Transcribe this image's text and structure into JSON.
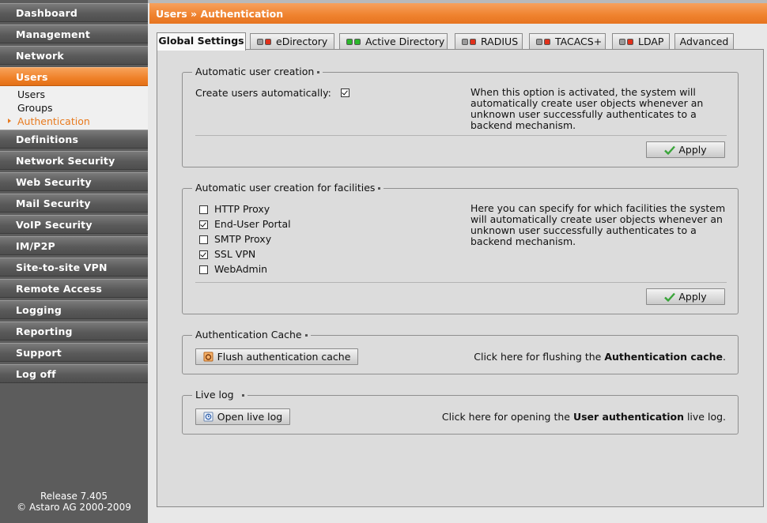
{
  "sidebar": {
    "items": [
      {
        "label": "Dashboard"
      },
      {
        "label": "Management"
      },
      {
        "label": "Network"
      },
      {
        "label": "Users"
      },
      {
        "label": "Definitions"
      },
      {
        "label": "Network Security"
      },
      {
        "label": "Web Security"
      },
      {
        "label": "Mail Security"
      },
      {
        "label": "VoIP Security"
      },
      {
        "label": "IM/P2P"
      },
      {
        "label": "Site-to-site VPN"
      },
      {
        "label": "Remote Access"
      },
      {
        "label": "Logging"
      },
      {
        "label": "Reporting"
      },
      {
        "label": "Support"
      },
      {
        "label": "Log off"
      }
    ],
    "active_index": 3,
    "subitems": [
      {
        "label": "Users"
      },
      {
        "label": "Groups"
      },
      {
        "label": "Authentication",
        "current": true
      }
    ],
    "footer": {
      "release": "Release 7.405",
      "copyright": "© Astaro AG 2000-2009"
    }
  },
  "header": {
    "breadcrumb": "Users » Authentication"
  },
  "tabs": [
    {
      "label": "Global Settings",
      "active": true,
      "led": ""
    },
    {
      "label": "eDirectory",
      "led": "red"
    },
    {
      "label": "Active Directory",
      "led": "green"
    },
    {
      "label": "RADIUS",
      "led": "red"
    },
    {
      "label": "TACACS+",
      "led": "red"
    },
    {
      "label": "LDAP",
      "led": "red"
    },
    {
      "label": "Advanced",
      "led": ""
    }
  ],
  "sections": {
    "auto_create": {
      "legend": "Automatic user creation",
      "checkbox_label": "Create users automatically:",
      "checked": true,
      "help": [
        "When this option is activated, the system will",
        "automatically create user objects whenever an",
        "unknown user successfully authenticates to a",
        "backend mechanism."
      ],
      "apply_label": "Apply"
    },
    "facilities": {
      "legend": "Automatic user creation for facilities",
      "options": [
        {
          "label": "HTTP Proxy",
          "checked": false
        },
        {
          "label": "End-User Portal",
          "checked": true
        },
        {
          "label": "SMTP Proxy",
          "checked": false
        },
        {
          "label": "SSL VPN",
          "checked": true
        },
        {
          "label": "WebAdmin",
          "checked": false
        }
      ],
      "help": [
        "Here you can specify for which facilities the system",
        "will automatically create user objects whenever an",
        "unknown user successfully authenticates to a",
        "backend mechanism."
      ],
      "apply_label": "Apply"
    },
    "cache": {
      "legend": "Authentication Cache",
      "button_label": "Flush authentication cache",
      "hint_prefix": "Click here for flushing the ",
      "hint_bold": "Authentication cache",
      "hint_suffix": "."
    },
    "live_log": {
      "legend": "Live log",
      "button_label": "Open live log",
      "hint_prefix": "Click here for opening the ",
      "hint_bold": "User authentication",
      "hint_suffix": " live log."
    }
  },
  "colors": {
    "accent": "#ef822e",
    "sidebar": "#5c5c5c",
    "panel": "#dcdcdc",
    "led_red": "#e0301a",
    "led_green": "#2cb82c"
  },
  "icons": {
    "apply": "check-icon",
    "flush": "flush-cache-icon",
    "live_log": "live-log-icon"
  }
}
